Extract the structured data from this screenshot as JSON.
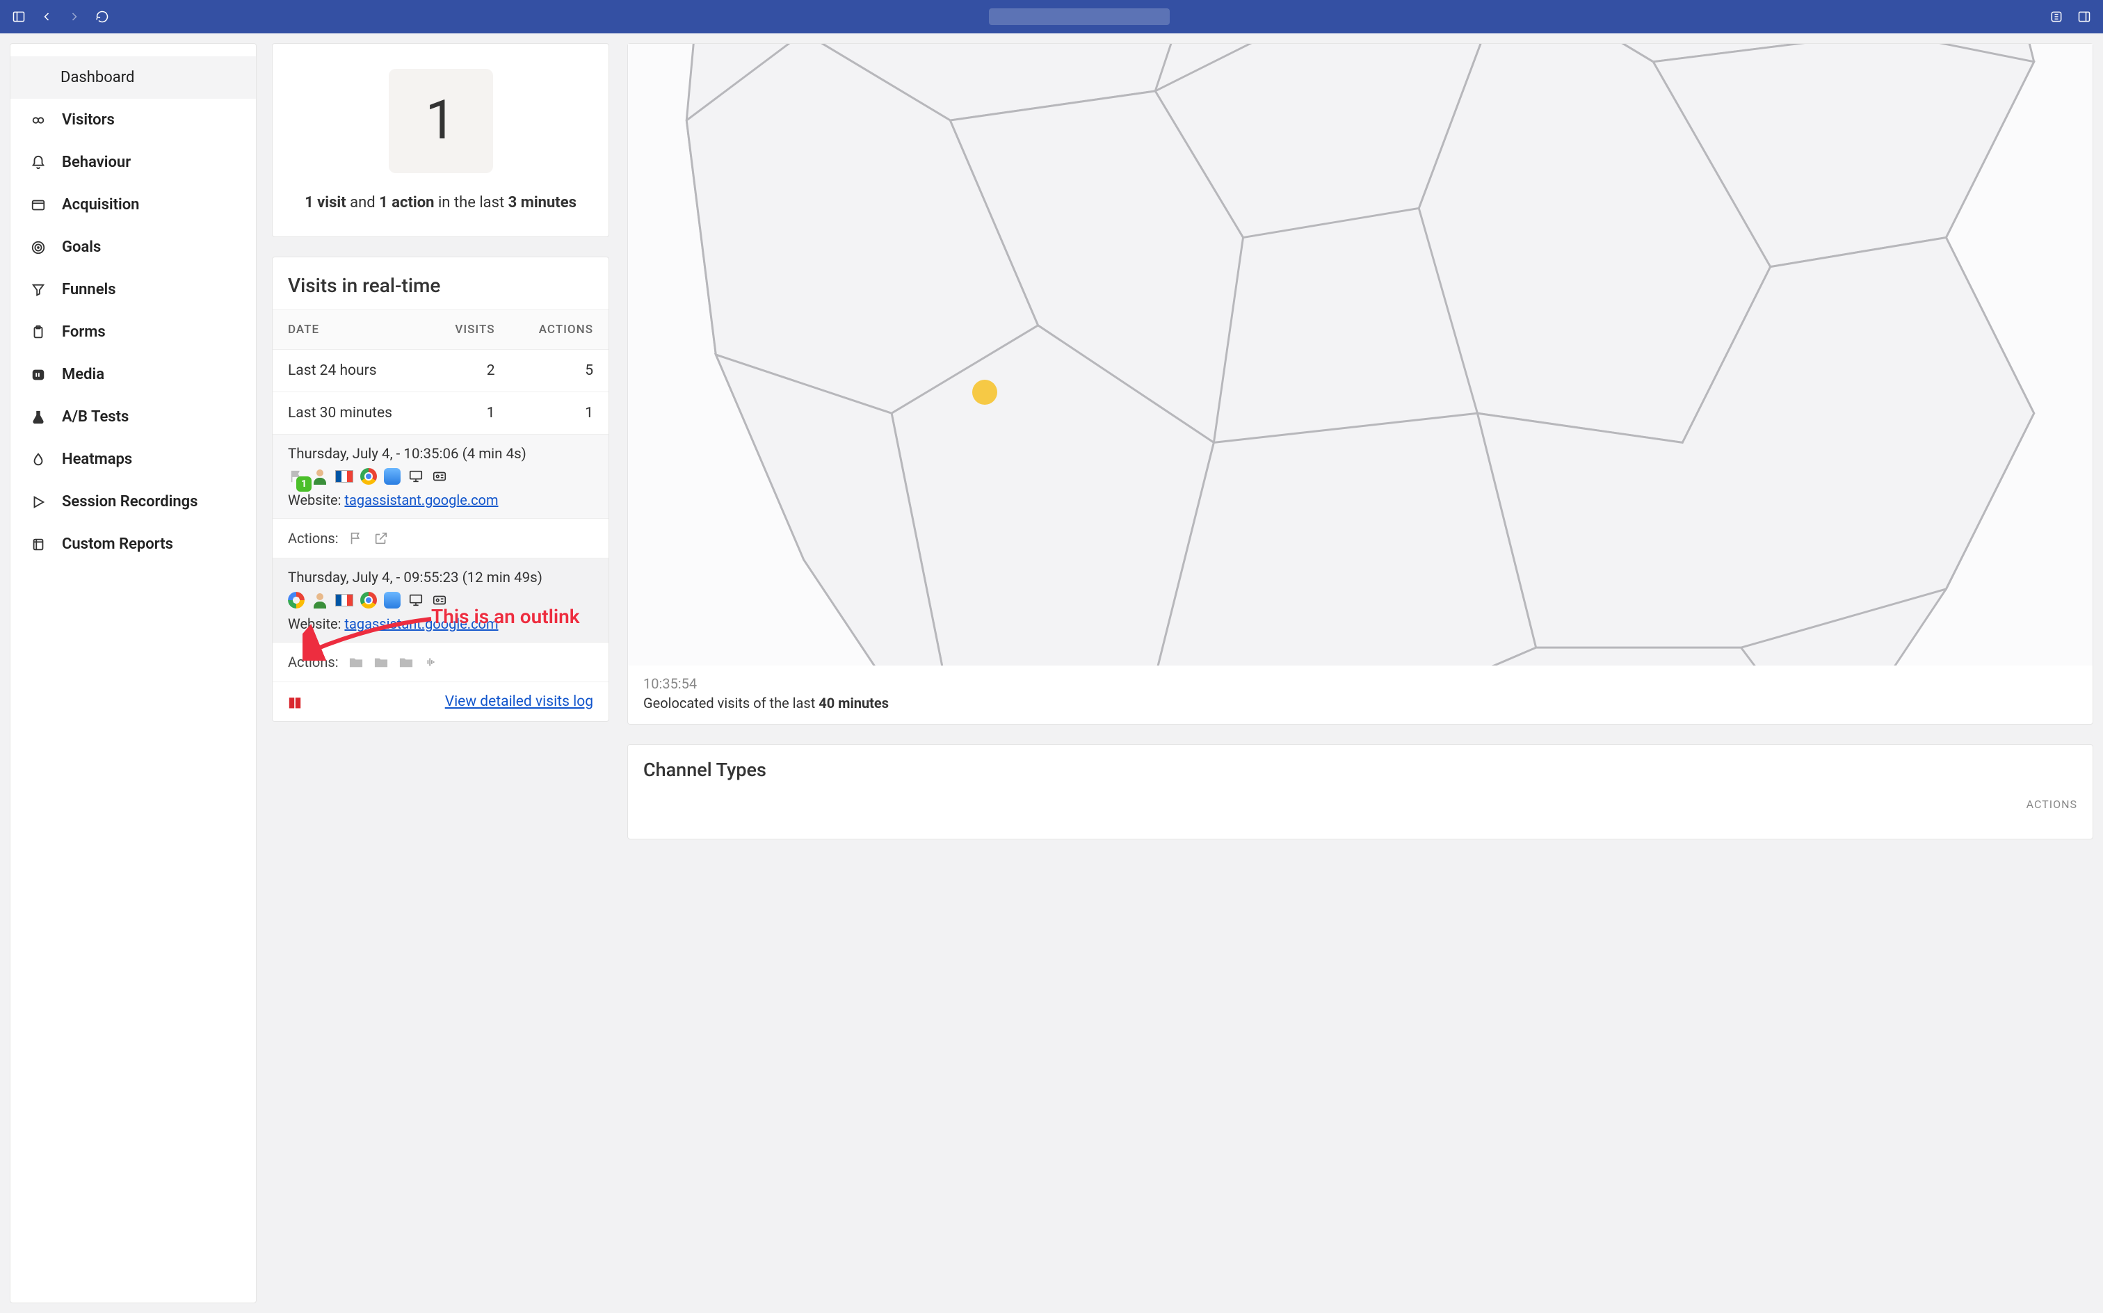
{
  "browser": {
    "address_placeholder": ""
  },
  "sidebar": {
    "dashboard": "Dashboard",
    "items": [
      {
        "label": "Visitors",
        "icon": "link"
      },
      {
        "label": "Behaviour",
        "icon": "bell"
      },
      {
        "label": "Acquisition",
        "icon": "window"
      },
      {
        "label": "Goals",
        "icon": "target"
      },
      {
        "label": "Funnels",
        "icon": "funnel"
      },
      {
        "label": "Forms",
        "icon": "clipboard"
      },
      {
        "label": "Media",
        "icon": "film"
      },
      {
        "label": "A/B Tests",
        "icon": "flask"
      },
      {
        "label": "Heatmaps",
        "icon": "drop"
      },
      {
        "label": "Session Recordings",
        "icon": "play"
      },
      {
        "label": "Custom Reports",
        "icon": "report"
      }
    ]
  },
  "kpi": {
    "value": "1",
    "summary_parts": {
      "visits_n": "1 visit",
      "and": " and ",
      "actions_n": "1 action",
      "mid": " in the last ",
      "minutes_n": "3 minutes"
    }
  },
  "realtime": {
    "title": "Visits in real-time",
    "headers": {
      "date": "DATE",
      "visits": "VISITS",
      "actions": "ACTIONS"
    },
    "rows": [
      {
        "label": "Last 24 hours",
        "visits": "2",
        "actions": "5"
      },
      {
        "label": "Last 30 minutes",
        "visits": "1",
        "actions": "1"
      }
    ],
    "visits": [
      {
        "datetime": "Thursday, July 4, - 10:35:06 (4 min 4s)",
        "website_prefix": "Website: ",
        "website": "tagassistant.google.com",
        "badge": "1",
        "icons": [
          "flag-grey",
          "person",
          "flag-fr",
          "chrome",
          "safari",
          "desktop",
          "idcard"
        ],
        "actions_label": "Actions:",
        "action_icons": [
          "flag",
          "outlink"
        ]
      },
      {
        "datetime": "Thursday, July 4, - 09:55:23 (12 min 49s)",
        "website_prefix": "Website: ",
        "website": "tagassistant.google.com",
        "icons": [
          "google",
          "person",
          "flag-fr",
          "chrome",
          "safari",
          "desktop",
          "idcard"
        ],
        "actions_label": "Actions:",
        "action_icons": [
          "folder",
          "folder",
          "folder",
          "waveform"
        ]
      }
    ],
    "footer_link": "View detailed visits log"
  },
  "map": {
    "timestamp": "10:35:54",
    "caption_pre": "Geolocated visits of the last ",
    "caption_bold": "40 minutes"
  },
  "channels": {
    "title": "Channel Types",
    "cols": {
      "left": "",
      "right": "ACTIONS"
    }
  },
  "annotation": {
    "text": "This is an outlink"
  }
}
